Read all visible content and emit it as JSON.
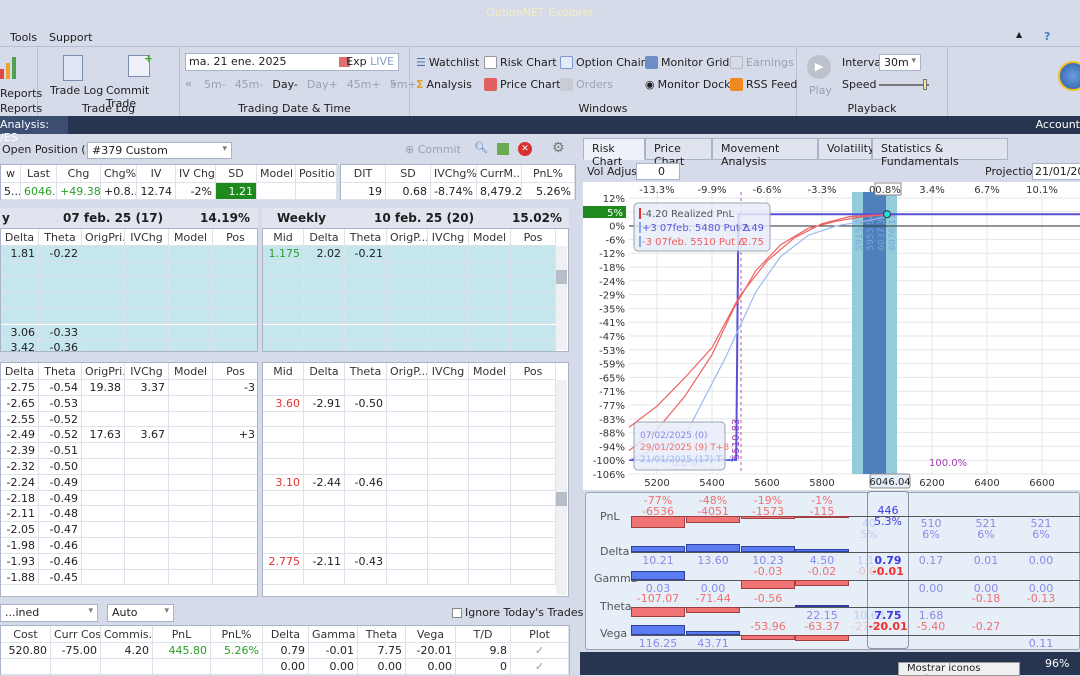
{
  "app": {
    "title": "OptionNET Explorer"
  },
  "menu": {
    "items": [
      "Tools",
      "Support"
    ]
  },
  "ribbon": {
    "reports": {
      "btn": "Reports",
      "group": "Reports"
    },
    "tradelog": {
      "trade_log": "Trade Log",
      "commit_trade": "Commit Trade",
      "group": "Trade Log"
    },
    "datetime": {
      "date": "ma. 21 ene. 2025",
      "exp": "Exp",
      "live": "LIVE",
      "steps": [
        "5m-",
        "45m-",
        "Day-",
        "Day+",
        "45m+",
        "5m+"
      ],
      "group": "Trading Date & Time"
    },
    "windows": {
      "items": [
        "Watchlist",
        "Risk Chart",
        "Option Chain",
        "Monitor Grid",
        "Earnings",
        "Analysis",
        "Price Chart",
        "Orders",
        "Monitor Dock",
        "RSS Feed"
      ],
      "group": "Windows"
    },
    "playback": {
      "play": "Play",
      "interval_label": "Interval",
      "interval": "30m",
      "speed_label": "Speed",
      "speed_level": 0.95,
      "group": "Playback"
    }
  },
  "navbar": {
    "tab": "Analysis: /ES",
    "account": "Account"
  },
  "position": {
    "label": "Open Position (1)",
    "selected": "#379 Custom",
    "commit": "Commit"
  },
  "summary": {
    "headers": [
      "w",
      "Last",
      "Chg",
      "Chg%",
      "IV",
      "IV Chg",
      "SD",
      "Model",
      "Position"
    ],
    "values": [
      "5...",
      "6046....",
      "+49.38",
      "+0.8...",
      "12.74",
      "-2%",
      "1.21",
      "",
      ""
    ],
    "headers2": [
      "DIT",
      "SD",
      "IVChg%",
      "CurrM...",
      "PnL%"
    ],
    "values2": [
      "19",
      "0.68",
      "-8.74%",
      "8,479.20",
      "5.26%"
    ]
  },
  "chains": {
    "left_head": {
      "name": "y",
      "date": "07 feb. 25 (17)",
      "iv": "14.19%"
    },
    "right_head": {
      "name": "Weekly",
      "date": "10 feb. 25 (20)",
      "iv": "15.02%"
    },
    "left_cols": [
      "Delta",
      "Theta",
      "OrigPri...",
      "IVChg",
      "Model",
      "Pos"
    ],
    "right_cols": [
      "Mid",
      "Delta",
      "Theta",
      "OrigP...",
      "IVChg",
      "Model",
      "Pos"
    ],
    "upper_left": [
      [
        "1.81",
        "-0.22"
      ],
      [],
      [],
      [],
      [],
      [
        "3.06",
        "-0.33"
      ],
      [
        "3.42",
        "-0.36"
      ]
    ],
    "upper_right": [
      [
        "1.175",
        "2.02",
        "-0.21"
      ],
      [],
      [],
      [],
      [],
      [],
      []
    ],
    "lower_left": [
      [
        "-2.75",
        "-0.54",
        "19.38",
        "3.37",
        "",
        "-3"
      ],
      [
        "-2.65",
        "-0.53"
      ],
      [
        "-2.55",
        "-0.52"
      ],
      [
        "-2.49",
        "-0.52",
        "17.63",
        "3.67",
        "",
        "+3"
      ],
      [
        "-2.39",
        "-0.51"
      ],
      [
        "-2.32",
        "-0.50"
      ],
      [
        "-2.24",
        "-0.49"
      ],
      [
        "-2.18",
        "-0.49"
      ],
      [
        "-2.11",
        "-0.48"
      ],
      [
        "-2.05",
        "-0.47"
      ],
      [
        "-1.98",
        "-0.46"
      ],
      [
        "-1.93",
        "-0.46"
      ],
      [
        "-1.88",
        "-0.45"
      ]
    ],
    "lower_right": [
      [],
      [
        "3.60",
        "-2.91",
        "-0.50"
      ],
      [],
      [],
      [],
      [],
      [
        "3.10",
        "-2.44",
        "-0.46"
      ],
      [],
      [],
      [],
      [],
      [
        "2.775",
        "-2.11",
        "-0.43"
      ],
      []
    ]
  },
  "bottom": {
    "mode": "...ined",
    "auto": "Auto",
    "ignore": "Ignore Today's Trades",
    "headers": [
      "Cost",
      "Curr Cost",
      "Commis...",
      "PnL",
      "PnL%",
      "Delta",
      "Gamma",
      "Theta",
      "Vega",
      "T/D",
      "Plot"
    ],
    "rows": [
      [
        "520.80",
        "-75.00",
        "4.20",
        "445.80",
        "5.26%",
        "0.79",
        "-0.01",
        "7.75",
        "-20.01",
        "9.8",
        "✓"
      ],
      [
        "",
        "",
        "",
        "",
        "",
        "0.00",
        "0.00",
        "0.00",
        "0.00",
        "0",
        "✓"
      ]
    ]
  },
  "right": {
    "tabs": [
      "Risk Chart",
      "Price Chart",
      "Movement Analysis",
      "Volatility",
      "Statistics & Fundamentals"
    ],
    "vol_label": "Vol Adjust",
    "vol": "0",
    "proj_label": "Projection",
    "proj": "21/01/2025"
  },
  "chart_data": {
    "type": "line",
    "xlabel": "Price",
    "ylabel": "PnL%",
    "y_ticks": [
      "12%",
      "5%",
      "0%",
      "-6%",
      "-12%",
      "-18%",
      "-24%",
      "-29%",
      "-35%",
      "-41%",
      "-47%",
      "-53%",
      "-59%",
      "-65%",
      "-71%",
      "-77%",
      "-83%",
      "-88%",
      "-94%",
      "-100%",
      "-106%"
    ],
    "ylim": [
      -106,
      12
    ],
    "xlim": [
      5098,
      6740
    ],
    "x_ticks": [
      5200,
      5400,
      5600,
      5800,
      6200,
      6400,
      6600
    ],
    "pct_ticks": [
      {
        "p": 5200,
        "t": "-13.3%"
      },
      {
        "p": 5400,
        "t": "-9.9%"
      },
      {
        "p": 5600,
        "t": "-6.6%"
      },
      {
        "p": 5800,
        "t": "-3.3%"
      },
      {
        "p": 6000,
        "t": "0.1"
      },
      {
        "p": 6200,
        "t": "3.4%"
      },
      {
        "p": 6400,
        "t": "6.7%"
      },
      {
        "p": 6600,
        "t": "10.1%"
      }
    ],
    "current_price": "6046.04",
    "current_pct": "0.8%",
    "current_pnl_label": "5%",
    "bands": [
      "5915.21",
      "5955.94",
      "6037.39",
      "6076.11"
    ],
    "breakeven": "5510.83",
    "prob_left": "0.0%",
    "prob_right": "100.0%",
    "series": [
      {
        "name": "07/02/2025 (0)",
        "color": "#5a4fd8",
        "points": [
          [
            5098,
            -100
          ],
          [
            5488,
            -100
          ],
          [
            5496,
            5
          ],
          [
            6740,
            5
          ]
        ]
      },
      {
        "name": "29/01/2025 (9) T+8",
        "color": "#f06060",
        "points": [
          [
            5098,
            -86
          ],
          [
            5200,
            -77
          ],
          [
            5300,
            -65
          ],
          [
            5400,
            -52
          ],
          [
            5500,
            -30
          ],
          [
            5600,
            -15
          ],
          [
            5700,
            -5
          ],
          [
            5800,
            1
          ],
          [
            5900,
            4
          ],
          [
            6046,
            5
          ]
        ]
      },
      {
        "name": "29/01/2025 (9) T+8b",
        "color": "#f06060",
        "points": [
          [
            5098,
            -96
          ],
          [
            5200,
            -87
          ],
          [
            5300,
            -73
          ],
          [
            5400,
            -55
          ],
          [
            5480,
            -35
          ],
          [
            5560,
            -19
          ],
          [
            5650,
            -8
          ],
          [
            5750,
            -1
          ],
          [
            5850,
            2
          ],
          [
            5950,
            4
          ],
          [
            6046,
            5
          ]
        ]
      },
      {
        "name": "21/01/2025 (17) T+0",
        "color": "#9ab8f2",
        "points": [
          [
            5098,
            -100
          ],
          [
            5300,
            -90
          ],
          [
            5450,
            -56
          ],
          [
            5560,
            -28
          ],
          [
            5650,
            -13
          ],
          [
            5750,
            -4
          ],
          [
            5850,
            0
          ],
          [
            5950,
            2
          ],
          [
            6046,
            4
          ]
        ]
      }
    ],
    "legend": [
      "07/02/2025 (0)",
      "29/01/2025 (9) T+8",
      "21/01/2025 (17) T+0"
    ],
    "tooltip": [
      {
        "q": "-4.20",
        "t": "Realized PnL",
        "v": ""
      },
      {
        "q": "+3",
        "t": "07feb. 5480 Put Δ",
        "v": "-2.49"
      },
      {
        "q": "-3",
        "t": "07feb. 5510 Put Δ",
        "v": "-2.75"
      }
    ]
  },
  "greeks": {
    "rows": [
      "PnL",
      "Delta",
      "Gamma",
      "Theta",
      "Vega"
    ],
    "pnl": [
      "-6536",
      "-4051",
      "-1573",
      "-115",
      "40",
      "446",
      "510",
      "521",
      "521"
    ],
    "pnl_pct": [
      "-77%",
      "-48%",
      "-19%",
      "-1%",
      "5%",
      "5.3%",
      "6%",
      "6%",
      "6%"
    ],
    "delta": [
      "10.21",
      "13.60",
      "10.23",
      "4.50",
      "1.17",
      "0.79",
      "0.17",
      "0.01",
      "0.00"
    ],
    "gamma": [
      "0.03",
      "0.00",
      "-0.03",
      "-0.02",
      "-0.01",
      "-0.01",
      "0.00",
      "0.00",
      "0.00"
    ],
    "theta": [
      "-107.07",
      "-71.44",
      "-0.56",
      "22.15",
      "10.63",
      "7.75",
      "1.68",
      "-0.18",
      "-0.13"
    ],
    "vega": [
      "116.25",
      "43.71",
      "-53.96",
      "-63.37",
      "-27.96",
      "-20.01",
      "-5.40",
      "-0.27",
      "0.11"
    ]
  },
  "status": {
    "zoom": "96%",
    "tooltip": "Mostrar iconos ocultos"
  }
}
